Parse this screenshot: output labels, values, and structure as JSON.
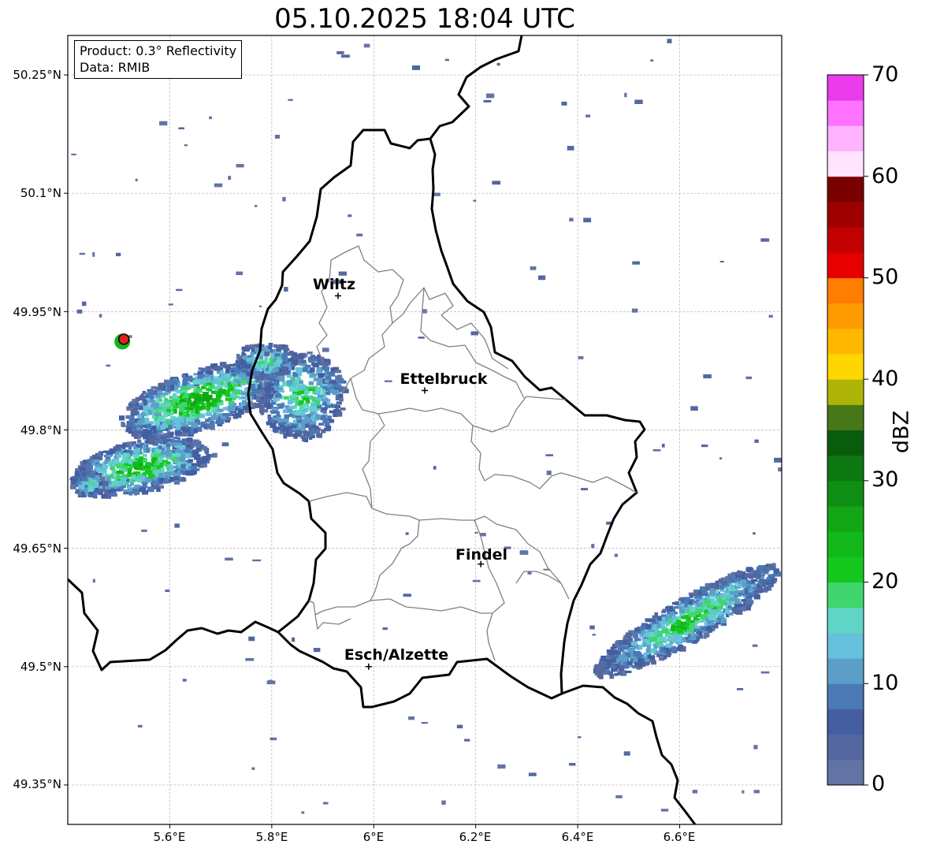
{
  "title": "05.10.2025 18:04 UTC",
  "info": {
    "product": "Product: 0.3° Reflectivity",
    "data_source": "Data: RMIB"
  },
  "latitude_labels": [
    "50.25°N",
    "50.1°N",
    "49.95°N",
    "49.8°N",
    "49.65°N",
    "49.5°N",
    "49.35°N"
  ],
  "longitude_labels": [
    "5.6°E",
    "5.8°E",
    "6°E",
    "6.2°E",
    "6.4°E",
    "6.6°E"
  ],
  "map_extent": {
    "lon_min": 5.4,
    "lon_max": 6.8,
    "lat_min": 49.3,
    "lat_max": 50.3
  },
  "cities": [
    {
      "name": "Wiltz",
      "lon": 5.93,
      "lat": 49.97
    },
    {
      "name": "Ettelbruck",
      "lon": 6.1,
      "lat": 49.85
    },
    {
      "name": "Findel",
      "lon": 6.21,
      "lat": 49.63
    },
    {
      "name": "Esch/Alzette",
      "lon": 5.99,
      "lat": 49.5
    }
  ],
  "radar_site": {
    "lon": 5.51,
    "lat": 49.915,
    "marker_color": "#e0201c"
  },
  "colorbar": {
    "label": "dBZ",
    "ticks": [
      "0",
      "10",
      "20",
      "30",
      "40",
      "50",
      "60",
      "70"
    ],
    "range": [
      0,
      70
    ],
    "colors": [
      "#6373a6",
      "#54689f",
      "#445ea2",
      "#4a79b6",
      "#5b9fc9",
      "#66c1dc",
      "#61d5c5",
      "#3ed66d",
      "#15c81e",
      "#12b81a",
      "#13a614",
      "#0f8e14",
      "#0d7711",
      "#0a5c0d",
      "#477716",
      "#adb406",
      "#ffd700",
      "#ffb700",
      "#ff9b00",
      "#ff7d00",
      "#e60000",
      "#c20000",
      "#9e0000",
      "#7a0000",
      "#ffe3ff",
      "#ffb3ff",
      "#ff73ff",
      "#eb3beb"
    ]
  },
  "colors": {
    "border": "#000000",
    "canton_lines": "#808080",
    "grid": "#b5b5b5"
  }
}
